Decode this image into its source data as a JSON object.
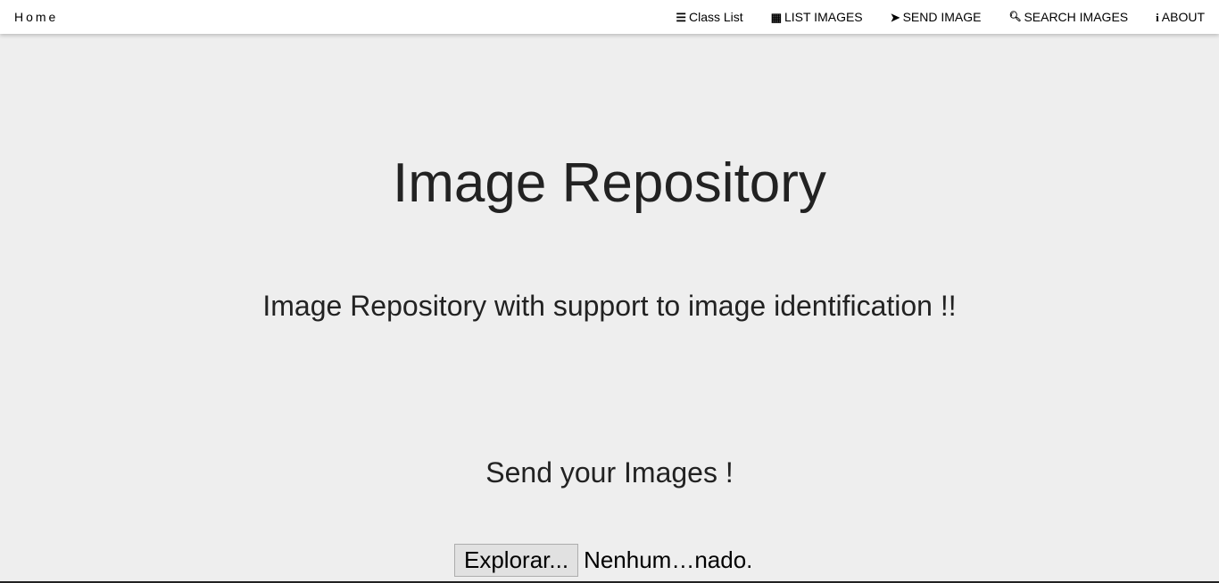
{
  "nav": {
    "home": "Home",
    "items": [
      {
        "icon": "☰",
        "label": "Class List"
      },
      {
        "icon": "▦",
        "label": "LIST IMAGES"
      },
      {
        "icon": "➤",
        "label": "SEND IMAGE"
      },
      {
        "icon": "🔍︎",
        "label": "SEARCH IMAGES"
      },
      {
        "icon": "i",
        "label": "ABOUT"
      }
    ]
  },
  "main": {
    "title": "Image Repository",
    "subtitle": "Image Repository with support to image identification !!",
    "send_heading": "Send your Images !",
    "file_button": "Explorar...",
    "file_status": "Nenhum…nado."
  }
}
